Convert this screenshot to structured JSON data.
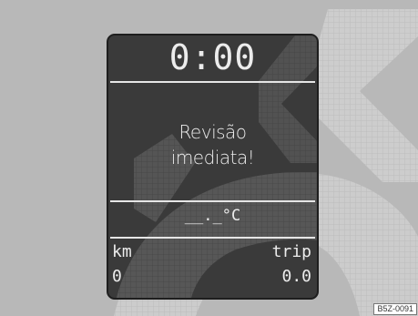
{
  "display": {
    "clock": "0:00",
    "message_line1": "Revisão",
    "message_line2": "imediata!",
    "temperature": "__._°C",
    "odometer_label": "km",
    "odometer_value": "0",
    "trip_label": "trip",
    "trip_value": "0.0"
  },
  "figure_code": "B5Z-0091",
  "colors": {
    "background": "#b8b8b8",
    "display_panel": "#3a3a3a",
    "display_text": "#ececec"
  },
  "icons": [
    "service-wrench-icon"
  ]
}
